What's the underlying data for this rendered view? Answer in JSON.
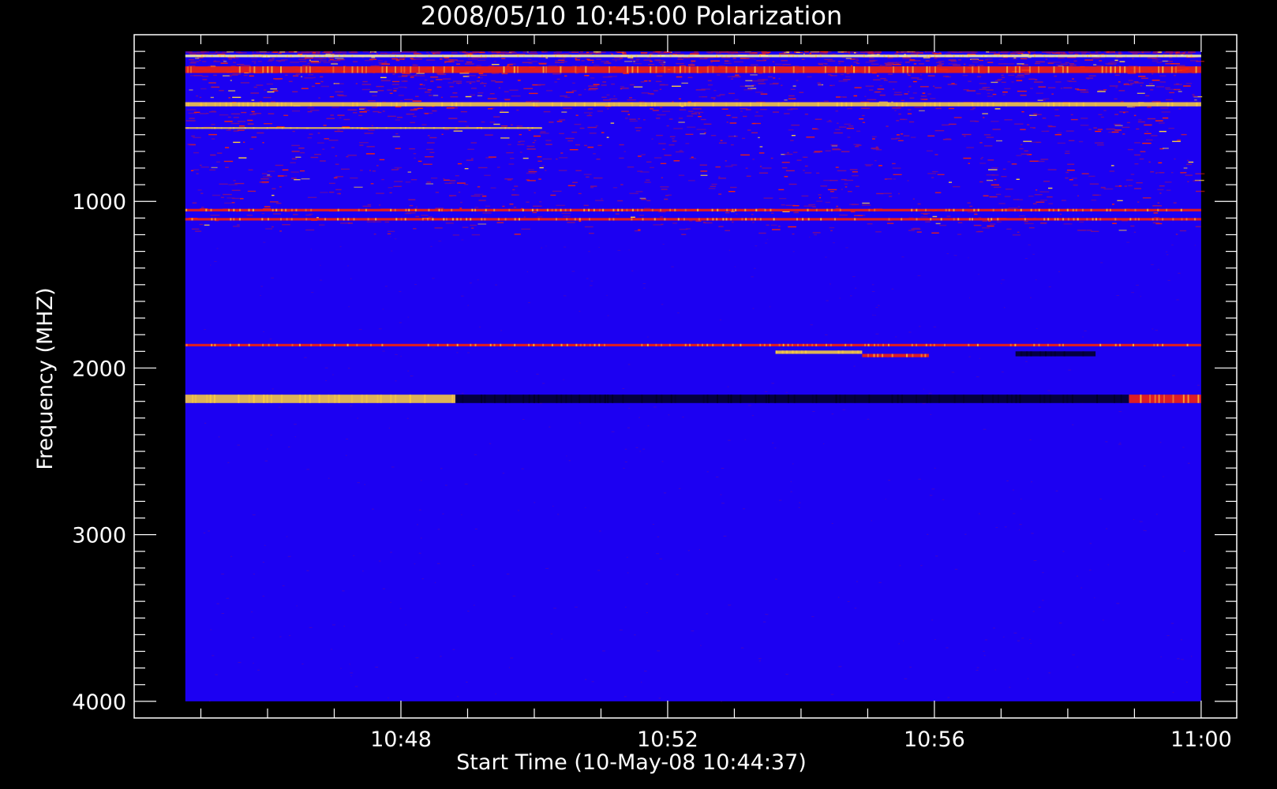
{
  "chart_data": {
    "type": "heatmap",
    "title": "2008/05/10 10:45:00 Polarization",
    "xlabel": "Start Time (10-May-08 10:44:37)",
    "ylabel": "Frequency (MHZ)",
    "x_ticks": [
      "10:48",
      "10:52",
      "10:56",
      "11:00"
    ],
    "x_tick_minutes": [
      3.383,
      7.383,
      11.383,
      15.383
    ],
    "x_range_minutes": [
      -0.617,
      15.917
    ],
    "x_data_range_minutes": [
      0.15,
      15.383
    ],
    "x_minor_step_minutes": 1,
    "y_ticks": [
      1000,
      2000,
      3000,
      4000
    ],
    "y_range": [
      0,
      4100
    ],
    "y_data_range": [
      100,
      4000
    ],
    "y_minor_step": 100,
    "y_reversed": true,
    "grid": false,
    "colors": {
      "background": "#000000",
      "base": "#1c00f2",
      "noise": "#8a0f7a",
      "enhanced": "#ff2200",
      "bright": "#ffd23c",
      "peak": "#ffffa0",
      "depressed": "#000020",
      "axis": "#ffffff"
    },
    "features": [
      {
        "kind": "band",
        "f_start": 120,
        "f_end": 135,
        "t_start": 0.15,
        "t_end": 15.383,
        "level": "peak"
      },
      {
        "kind": "band",
        "f_start": 190,
        "f_end": 230,
        "t_start": 0.15,
        "t_end": 15.383,
        "level": "enhanced"
      },
      {
        "kind": "band",
        "f_start": 405,
        "f_end": 430,
        "t_start": 0.15,
        "t_end": 15.383,
        "level": "bright"
      },
      {
        "kind": "band",
        "f_start": 555,
        "f_end": 565,
        "t_start": 0.15,
        "t_end": 5.5,
        "level": "bright"
      },
      {
        "kind": "band",
        "f_start": 1045,
        "f_end": 1060,
        "t_start": 0.15,
        "t_end": 15.383,
        "level": "enhanced"
      },
      {
        "kind": "band",
        "f_start": 1100,
        "f_end": 1115,
        "t_start": 0.15,
        "t_end": 15.383,
        "level": "enhanced"
      },
      {
        "kind": "band",
        "f_start": 1855,
        "f_end": 1870,
        "t_start": 0.15,
        "t_end": 15.383,
        "level": "enhanced"
      },
      {
        "kind": "band",
        "f_start": 1895,
        "f_end": 1915,
        "t_start": 9.0,
        "t_end": 10.3,
        "level": "bright"
      },
      {
        "kind": "band",
        "f_start": 1915,
        "f_end": 1935,
        "t_start": 10.3,
        "t_end": 11.3,
        "level": "enhanced"
      },
      {
        "kind": "band",
        "f_start": 1900,
        "f_end": 1930,
        "t_start": 12.6,
        "t_end": 13.8,
        "level": "depressed"
      },
      {
        "kind": "band",
        "f_start": 2160,
        "f_end": 2210,
        "t_start": 0.15,
        "t_end": 4.2,
        "level": "bright"
      },
      {
        "kind": "band",
        "f_start": 2160,
        "f_end": 2210,
        "t_start": 4.2,
        "t_end": 14.3,
        "level": "depressed"
      },
      {
        "kind": "band",
        "f_start": 2160,
        "f_end": 2210,
        "t_start": 14.3,
        "t_end": 15.383,
        "level": "enhanced"
      }
    ]
  }
}
